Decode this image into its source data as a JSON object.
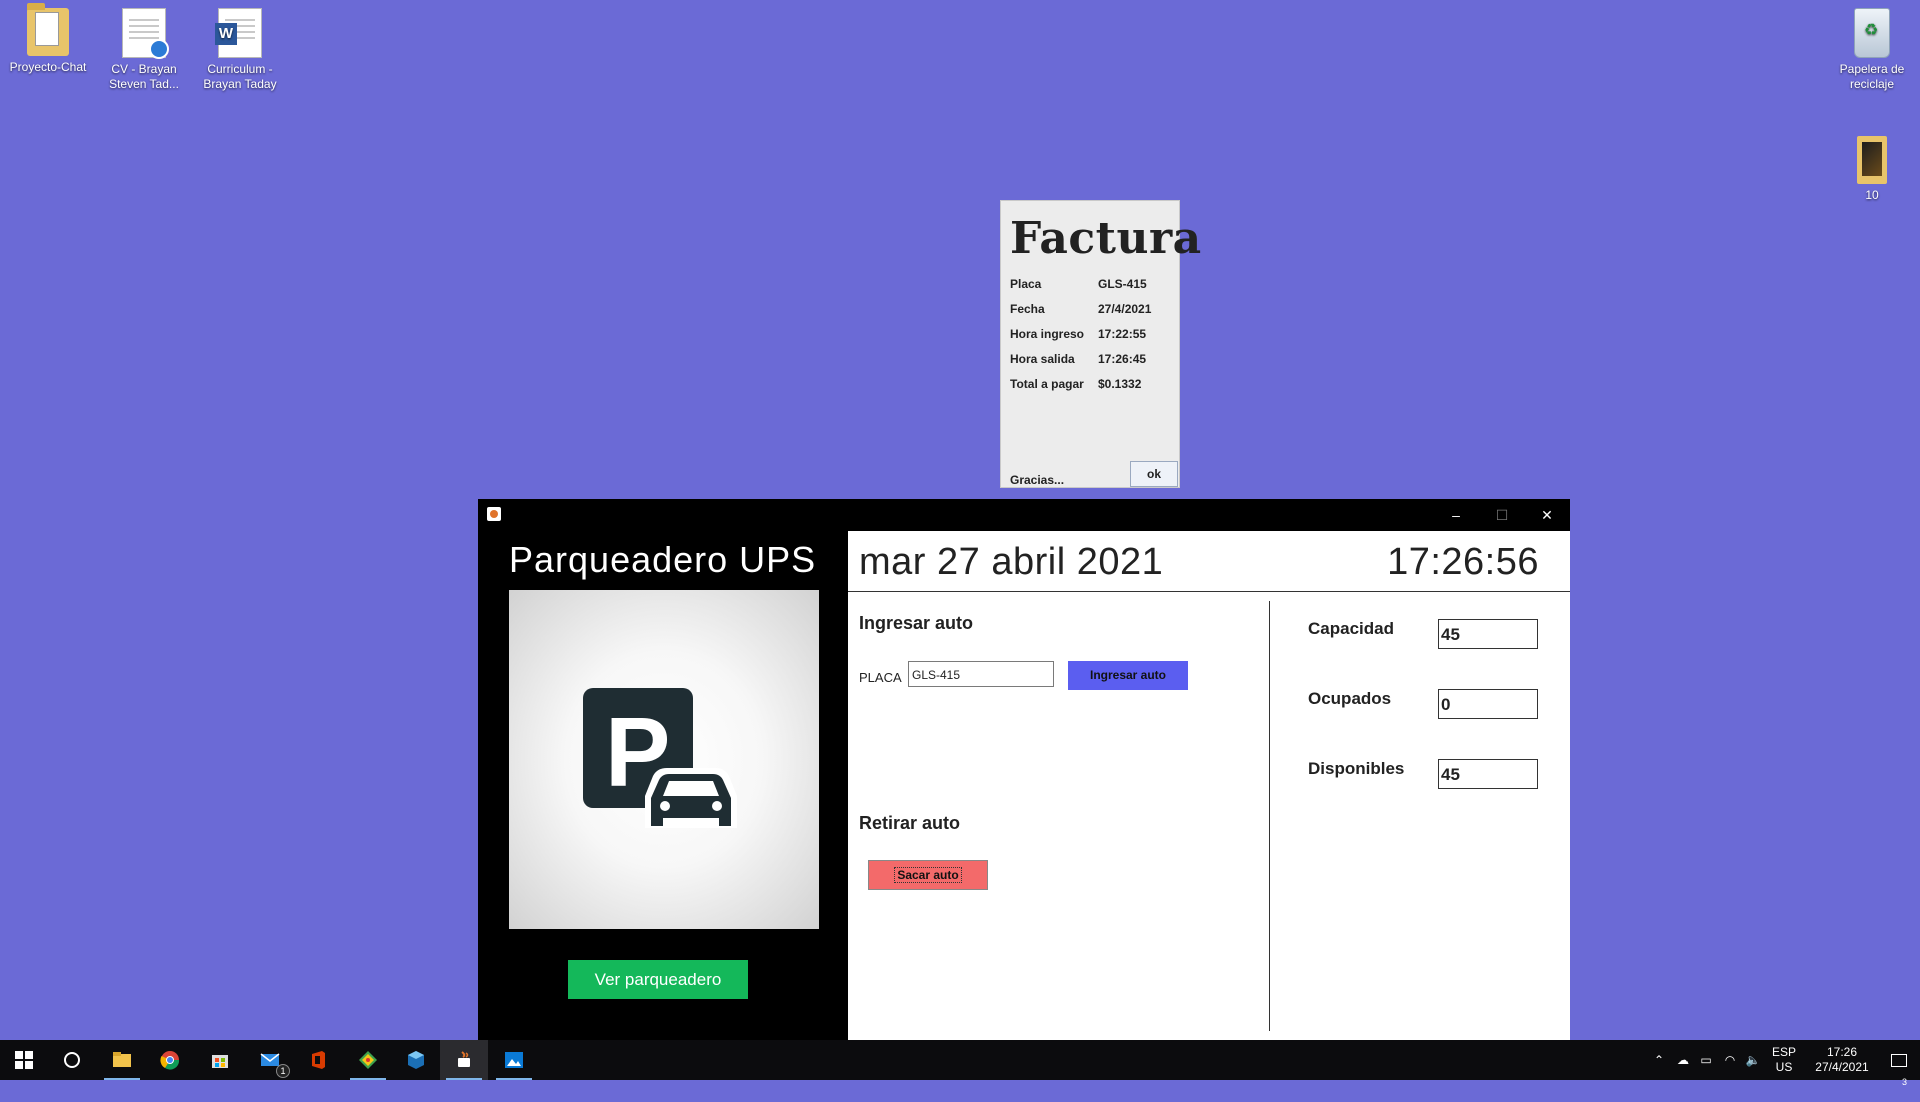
{
  "desktop": {
    "icons": [
      {
        "label": "Proyecto-Chat",
        "icon": "folder-icon"
      },
      {
        "label": "CV - Brayan Steven Tad...",
        "icon": "pdf-document-icon"
      },
      {
        "label": "Curriculum - Brayan Taday",
        "icon": "word-document-icon"
      },
      {
        "label": "Papelera de reciclaje",
        "icon": "recycle-bin-icon"
      },
      {
        "label": "10",
        "icon": "folder-icon"
      }
    ]
  },
  "factura": {
    "title": "Factura",
    "rows": [
      {
        "label": "Placa",
        "value": "GLS-415"
      },
      {
        "label": "Fecha",
        "value": "27/4/2021"
      },
      {
        "label": "Hora ingreso",
        "value": "17:22:55"
      },
      {
        "label": "Hora salida",
        "value": "17:26:45"
      },
      {
        "label": "Total a pagar",
        "value": "$0.1332"
      }
    ],
    "footer": "Gracias...",
    "ok_label": "ok"
  },
  "window": {
    "controls": {
      "minimize": "–",
      "maximize": "☐",
      "close": "✕"
    },
    "app_title": "Parqueadero UPS",
    "ver_button": "Ver parqueadero",
    "date": "mar 27 abril 2021",
    "time": "17:26:56",
    "ingresar": {
      "heading": "Ingresar auto",
      "placa_label": "PLACA",
      "placa_value": "GLS-415",
      "button": "Ingresar auto"
    },
    "retirar": {
      "heading": "Retirar auto",
      "button": "Sacar auto"
    },
    "stats": [
      {
        "label": "Capacidad",
        "value": "45"
      },
      {
        "label": "Ocupados",
        "value": "0"
      },
      {
        "label": "Disponibles",
        "value": "45"
      }
    ]
  },
  "taskbar": {
    "apps": [
      "start-icon",
      "search-icon",
      "file-explorer-icon",
      "chrome-icon",
      "store-icon",
      "mail-icon",
      "office-icon",
      "git-icon",
      "virtualbox-icon",
      "java-icon",
      "photos-icon"
    ],
    "mail_badge": "1",
    "tray": {
      "language": "ESP",
      "layout": "US",
      "clock_time": "17:26",
      "clock_date": "27/4/2021",
      "notification_count": "3"
    }
  },
  "colors": {
    "desktop_bg": "#6b6ad6",
    "ingresar_btn": "#5b5ef0",
    "sacar_btn": "#f36a6a",
    "ver_btn": "#14b85a"
  }
}
